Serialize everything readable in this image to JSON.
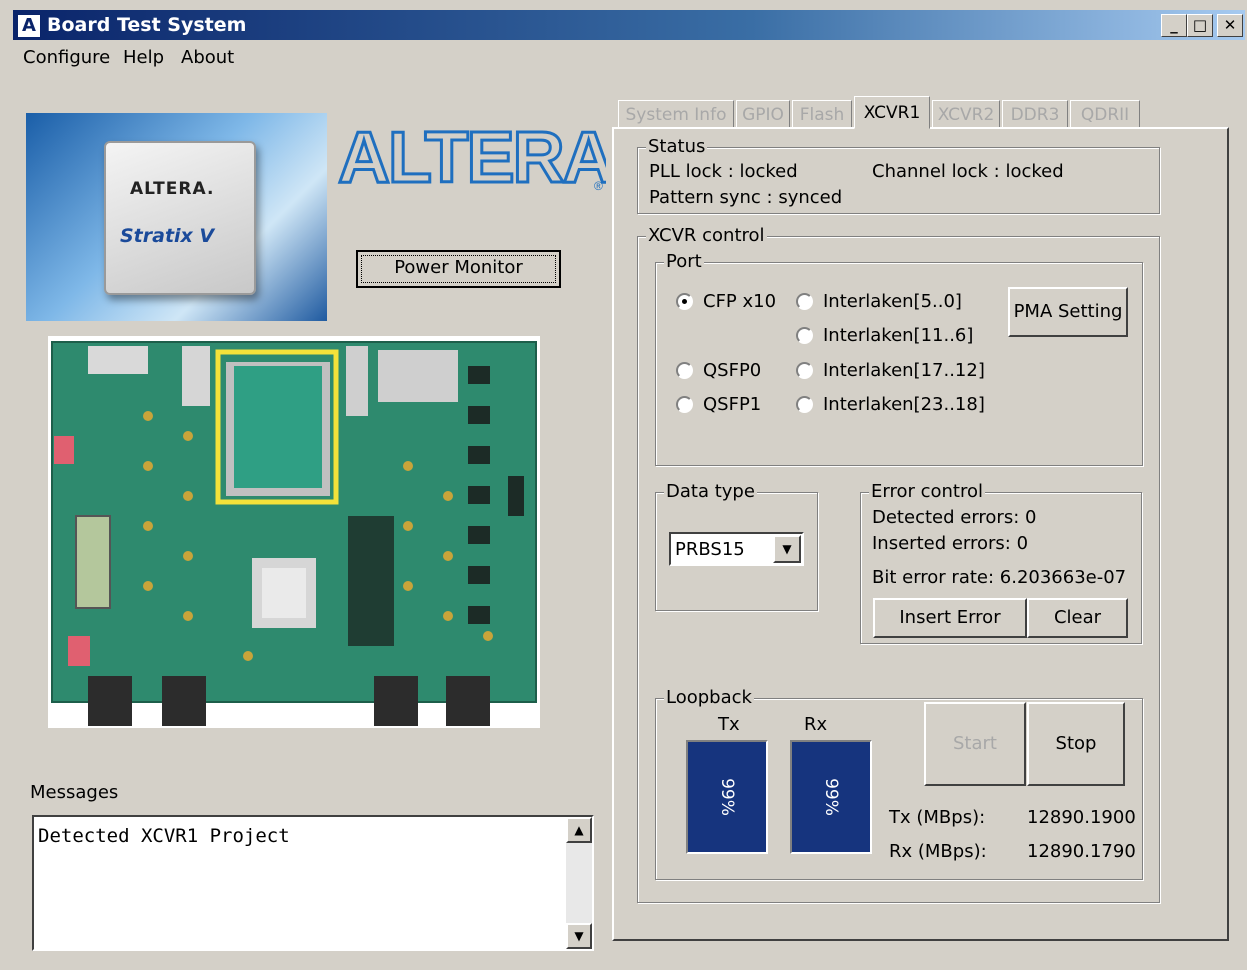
{
  "window": {
    "title": "Board Test System",
    "icon_letter": "A",
    "minimize": "_",
    "maximize": "□",
    "close": "✕"
  },
  "menu": {
    "items": [
      "Configure",
      "Help",
      "About"
    ]
  },
  "product": {
    "chip_brand": "ALTERA.",
    "chip_family": "Stratix V",
    "logo_text": "ALTERA",
    "power_monitor_label": "Power Monitor"
  },
  "messages": {
    "label": "Messages",
    "text": "Detected XCVR1 Project"
  },
  "tabs": [
    "System Info",
    "GPIO",
    "Flash",
    "XCVR1",
    "XCVR2",
    "DDR3",
    "QDRII"
  ],
  "active_tab": "XCVR1",
  "status": {
    "title": "Status",
    "pll_lock": "PLL lock : locked",
    "channel_lock": "Channel lock : locked",
    "pattern_sync": "Pattern sync : synced"
  },
  "xcvr_control": {
    "title": "XCVR control",
    "port_title": "Port",
    "ports": {
      "cfp": "CFP x10",
      "qsfp0": "QSFP0",
      "qsfp1": "QSFP1",
      "il_5_0": "Interlaken[5..0]",
      "il_11_6": "Interlaken[11..6]",
      "il_17_12": "Interlaken[17..12]",
      "il_23_18": "Interlaken[23..18]"
    },
    "selected_port": "CFP x10",
    "pma_setting_label": "PMA Setting"
  },
  "data_type": {
    "title": "Data type",
    "value": "PRBS15"
  },
  "error_control": {
    "title": "Error control",
    "detected": "Detected errors: 0",
    "inserted": "Inserted errors: 0",
    "bit_error_rate": "Bit error rate: 6.203663e-07",
    "insert_error_label": "Insert Error",
    "clear_label": "Clear"
  },
  "loopback": {
    "title": "Loopback",
    "tx_label": "Tx",
    "rx_label": "Rx",
    "tx_percent": "99%",
    "rx_percent": "99%",
    "start_label": "Start",
    "stop_label": "Stop",
    "tx_rate_label": "Tx (MBps):",
    "tx_rate": "12890.1900",
    "rx_rate_label": "Rx (MBps):",
    "rx_rate": "12890.1790"
  },
  "colors": {
    "meter": "#16347e",
    "title_bar": "#0a246a",
    "logo": "#1f6fbf"
  }
}
